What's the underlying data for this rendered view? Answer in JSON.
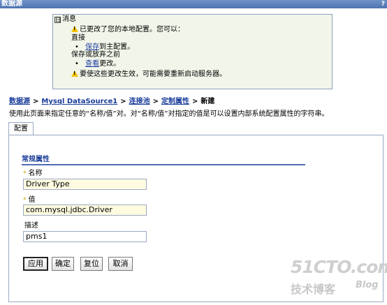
{
  "window": {
    "title": "数据源",
    "control": "?"
  },
  "messages": {
    "header": "消息",
    "toggle": "日",
    "line1": "已更改了您的本地配置。您可以：",
    "direct": "直接",
    "save_link": "保存",
    "save_rest": "到主配置。",
    "save_or_discard": "保存或放弃之前",
    "review_link": "查看",
    "review_rest": "更改。",
    "restart_note": "要使这些更改生效，可能需要重新启动服务器。"
  },
  "breadcrumb": {
    "items": [
      "数据源",
      "Mysql DataSource1",
      "连接池",
      "定制属性"
    ],
    "current": "新建",
    "separator": ">"
  },
  "description": "使用此页面来指定任意的“名称/值”对。对“名称/值”对指定的值是可以设置内部系统配置属性的字符串。",
  "tabs": {
    "config": "配置"
  },
  "section": {
    "general_properties": "常规属性"
  },
  "form": {
    "name_label": "名称",
    "name_value": "Driver Type",
    "value_label": "值",
    "value_value": "com.mysql.jdbc.Driver",
    "desc_label": "描述",
    "desc_value": "pms1",
    "required_marker": "*"
  },
  "buttons": {
    "apply": "应用",
    "ok": "确定",
    "reset": "复位",
    "cancel": "取消"
  },
  "watermark": {
    "brand": "51CTO.com",
    "sub": "技术博客",
    "blog": "Blog"
  }
}
